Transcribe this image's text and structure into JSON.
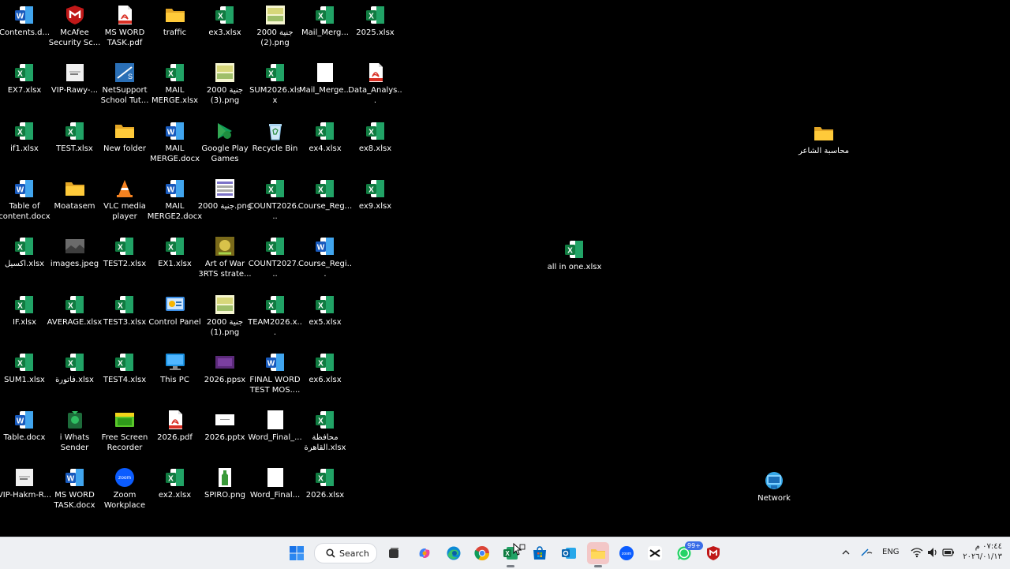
{
  "desktop": {
    "icons": [
      {
        "label": "Contents.d...",
        "type": "word",
        "col": 0,
        "row": 0
      },
      {
        "label": "McAfee Security Sc...",
        "type": "mcafee",
        "col": 1,
        "row": 0
      },
      {
        "label": "MS WORD TASK.pdf",
        "type": "pdf",
        "col": 2,
        "row": 0
      },
      {
        "label": "traffic",
        "type": "folder",
        "col": 3,
        "row": 0
      },
      {
        "label": "ex3.xlsx",
        "type": "excel",
        "col": 4,
        "row": 0
      },
      {
        "label": "2000 جنية (2).png",
        "type": "image",
        "col": 5,
        "row": 0
      },
      {
        "label": "Mail_Merg...",
        "type": "excel",
        "col": 6,
        "row": 0
      },
      {
        "label": "2025.xlsx",
        "type": "excel",
        "col": 7,
        "row": 0
      },
      {
        "label": "EX7.xlsx",
        "type": "excel",
        "col": 0,
        "row": 1
      },
      {
        "label": "VIP-Rawy-...",
        "type": "doc-image",
        "col": 1,
        "row": 1
      },
      {
        "label": "NetSupport School Tut...",
        "type": "netsupport",
        "col": 2,
        "row": 1
      },
      {
        "label": "MAIL MERGE.xlsx",
        "type": "excel",
        "col": 3,
        "row": 1
      },
      {
        "label": "2000 جنية (3).png",
        "type": "image",
        "col": 4,
        "row": 1
      },
      {
        "label": "SUM2026.xlsx",
        "type": "excel",
        "col": 5,
        "row": 1
      },
      {
        "label": "Mail_Merge...",
        "type": "blank",
        "col": 6,
        "row": 1
      },
      {
        "label": "Data_Analys...",
        "type": "pdf",
        "col": 7,
        "row": 1
      },
      {
        "label": "if1.xlsx",
        "type": "excel",
        "col": 0,
        "row": 2
      },
      {
        "label": "TEST.xlsx",
        "type": "excel",
        "col": 1,
        "row": 2
      },
      {
        "label": "New folder",
        "type": "folder",
        "col": 2,
        "row": 2
      },
      {
        "label": "MAIL MERGE.docx",
        "type": "word",
        "col": 3,
        "row": 2
      },
      {
        "label": "Google Play Games",
        "type": "playgames",
        "col": 4,
        "row": 2
      },
      {
        "label": "Recycle Bin",
        "type": "recycle",
        "col": 5,
        "row": 2
      },
      {
        "label": "ex4.xlsx",
        "type": "excel",
        "col": 6,
        "row": 2
      },
      {
        "label": "ex8.xlsx",
        "type": "excel",
        "col": 7,
        "row": 2
      },
      {
        "label": "Table of content.docx",
        "type": "word",
        "col": 0,
        "row": 3
      },
      {
        "label": "Moatasem",
        "type": "folder",
        "col": 1,
        "row": 3
      },
      {
        "label": "VLC media player",
        "type": "vlc",
        "col": 2,
        "row": 3
      },
      {
        "label": "MAIL MERGE2.docx",
        "type": "word",
        "col": 3,
        "row": 3
      },
      {
        "label": "2000 جنية.png",
        "type": "image2",
        "col": 4,
        "row": 3
      },
      {
        "label": "COUNT2026....",
        "type": "excel",
        "col": 5,
        "row": 3
      },
      {
        "label": "Course_Reg...",
        "type": "excel",
        "col": 6,
        "row": 3
      },
      {
        "label": "ex9.xlsx",
        "type": "excel",
        "col": 7,
        "row": 3
      },
      {
        "label": "اكسيل.xlsx",
        "type": "excel",
        "col": 0,
        "row": 4
      },
      {
        "label": "images.jpeg",
        "type": "photo",
        "col": 1,
        "row": 4
      },
      {
        "label": "TEST2.xlsx",
        "type": "excel",
        "col": 2,
        "row": 4
      },
      {
        "label": "EX1.xlsx",
        "type": "excel",
        "col": 3,
        "row": 4
      },
      {
        "label": "Art of War 3RTS strate...",
        "type": "game",
        "col": 4,
        "row": 4
      },
      {
        "label": "COUNT2027....",
        "type": "excel",
        "col": 5,
        "row": 4
      },
      {
        "label": "Course_Regi...",
        "type": "word",
        "col": 6,
        "row": 4
      },
      {
        "label": "IF.xlsx",
        "type": "excel",
        "col": 0,
        "row": 5
      },
      {
        "label": "AVERAGE.xlsx",
        "type": "excel",
        "col": 1,
        "row": 5
      },
      {
        "label": "TEST3.xlsx",
        "type": "excel",
        "col": 2,
        "row": 5
      },
      {
        "label": "Control Panel",
        "type": "control",
        "col": 3,
        "row": 5
      },
      {
        "label": "2000 جنية (1).png",
        "type": "image",
        "col": 4,
        "row": 5
      },
      {
        "label": "TEAM2026.x...",
        "type": "excel",
        "col": 5,
        "row": 5
      },
      {
        "label": "ex5.xlsx",
        "type": "excel",
        "col": 6,
        "row": 5
      },
      {
        "label": "SUM1.xlsx",
        "type": "excel",
        "col": 0,
        "row": 6
      },
      {
        "label": "فاتورة.xlsx",
        "type": "excel",
        "col": 1,
        "row": 6
      },
      {
        "label": "TEST4.xlsx",
        "type": "excel",
        "col": 2,
        "row": 6
      },
      {
        "label": "This PC",
        "type": "thispc",
        "col": 3,
        "row": 6
      },
      {
        "label": "2026.ppsx",
        "type": "ppsx",
        "col": 4,
        "row": 6
      },
      {
        "label": "FINAL WORD TEST MOS....",
        "type": "word",
        "col": 5,
        "row": 6
      },
      {
        "label": "ex6.xlsx",
        "type": "excel",
        "col": 6,
        "row": 6
      },
      {
        "label": "Table.docx",
        "type": "word",
        "col": 0,
        "row": 7
      },
      {
        "label": "i Whats Sender",
        "type": "whats",
        "col": 1,
        "row": 7
      },
      {
        "label": "Free Screen Recorder",
        "type": "recorder",
        "col": 2,
        "row": 7
      },
      {
        "label": "2026.pdf",
        "type": "pdf",
        "col": 3,
        "row": 7
      },
      {
        "label": "2026.pptx",
        "type": "pptx",
        "col": 4,
        "row": 7
      },
      {
        "label": "Word_Final_...",
        "type": "blank",
        "col": 5,
        "row": 7
      },
      {
        "label": "محافظة القاهرة.xlsx",
        "type": "excel",
        "col": 6,
        "row": 7
      },
      {
        "label": "VIP-Hakm-R...",
        "type": "doc-image",
        "col": 0,
        "row": 8
      },
      {
        "label": "MS WORD TASK.docx",
        "type": "word",
        "col": 1,
        "row": 8
      },
      {
        "label": "Zoom Workplace",
        "type": "zoom",
        "col": 2,
        "row": 8
      },
      {
        "label": "ex2.xlsx",
        "type": "excel",
        "col": 3,
        "row": 8
      },
      {
        "label": "SPIRO.png",
        "type": "spiro",
        "col": 4,
        "row": 8
      },
      {
        "label": "Word_Final...",
        "type": "blank",
        "col": 5,
        "row": 8
      },
      {
        "label": "2026.xlsx",
        "type": "excel",
        "col": 6,
        "row": 8
      }
    ],
    "extra": [
      {
        "label": "all in one.xlsx",
        "type": "excel",
        "pos": "all-in-one"
      },
      {
        "label": "محاسبة الشاعر",
        "type": "folder",
        "pos": "accounting"
      },
      {
        "label": "Network",
        "type": "network",
        "pos": "network"
      }
    ]
  },
  "taskbar": {
    "search_label": "Search",
    "language": "ENG",
    "clock_time": "٠٧:٤٤ م",
    "clock_date": "٢٠٢٦/٠١/١٣",
    "whatsapp_badge": "99+",
    "apps": [
      "start",
      "search",
      "task-view",
      "copilot",
      "edge",
      "chrome",
      "excel",
      "store",
      "outlook",
      "file-explorer",
      "zoom",
      "capcut",
      "whatsapp",
      "mcafee"
    ]
  }
}
